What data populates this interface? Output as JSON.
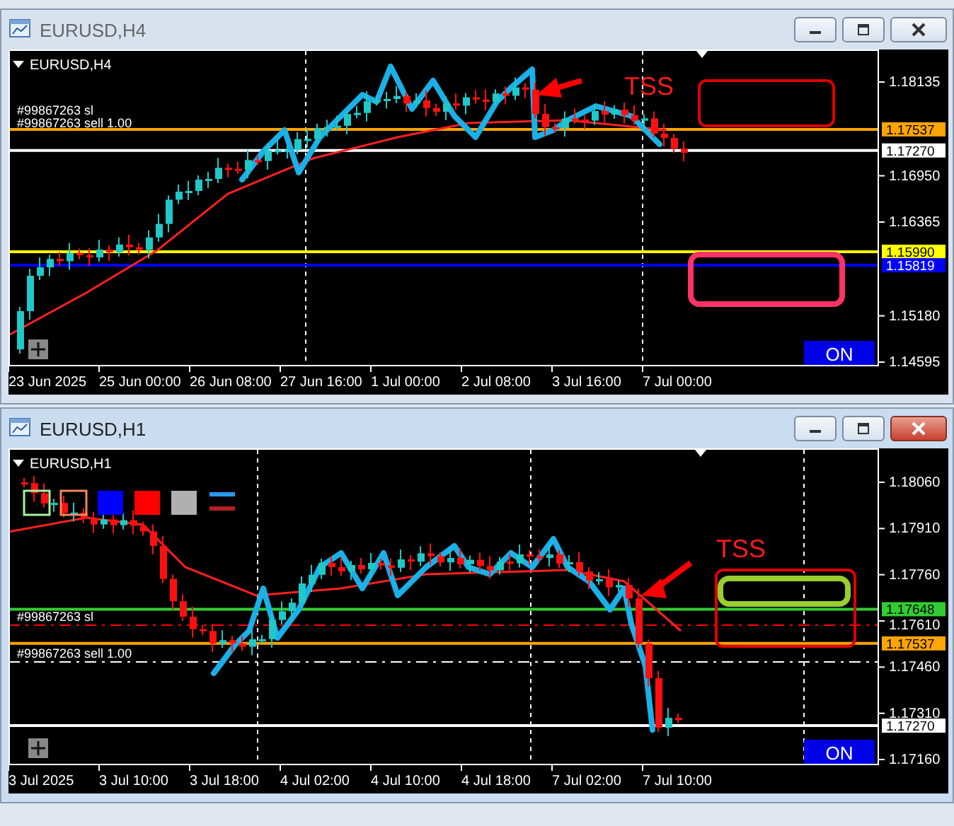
{
  "windows": [
    {
      "title": "EURUSD,H4",
      "active": false,
      "symbol_label": "EURUSD,H4",
      "price_ticks": [
        "1.18135",
        "1.16950",
        "1.16365",
        "1.15180",
        "1.14595"
      ],
      "price_tags": [
        {
          "label": "1.17537",
          "color": "#ffa500"
        },
        {
          "label": "1.17270",
          "color": "#ffffff"
        },
        {
          "label": "1.15990",
          "color": "#ffff00"
        },
        {
          "label": "1.15819",
          "color": "#0000ff"
        }
      ],
      "order_labels": [
        "#99867263 sl",
        "#99867263 sell 1.00"
      ],
      "time_labels": [
        "23 Jun 2025",
        "25 Jun 00:00",
        "26 Jun 08:00",
        "27 Jun 16:00",
        "1 Jul 00:00",
        "2 Jul 08:00",
        "3 Jul 16:00",
        "7 Jul 00:00"
      ],
      "annotation": "TSS",
      "toggle": "ON"
    },
    {
      "title": "EURUSD,H1",
      "active": true,
      "symbol_label": "EURUSD,H1",
      "price_ticks": [
        "1.18060",
        "1.17910",
        "1.17760",
        "1.17610",
        "1.17460",
        "1.17310",
        "1.17160"
      ],
      "price_tags": [
        {
          "label": "1.17648",
          "color": "#32cd32"
        },
        {
          "label": "1.17537",
          "color": "#ffa500"
        },
        {
          "label": "1.17270",
          "color": "#ffffff"
        }
      ],
      "order_labels": [
        "#99867263 sl",
        "#99867263 sell 1.00"
      ],
      "time_labels": [
        "3 Jul 2025",
        "3 Jul 10:00",
        "3 Jul 18:00",
        "4 Jul 02:00",
        "4 Jul 10:00",
        "4 Jul 18:00",
        "7 Jul 02:00",
        "7 Jul 10:00"
      ],
      "annotation": "TSS",
      "toggle": "ON"
    }
  ]
}
